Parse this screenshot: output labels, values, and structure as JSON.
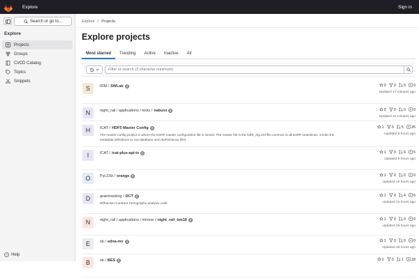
{
  "topbar": {
    "app_name": "Explore",
    "sign_in": "Sign in"
  },
  "sidebar": {
    "search_label": "Search or go to...",
    "title": "Explore",
    "items": [
      {
        "label": "Projects",
        "icon": "project-icon",
        "active": true
      },
      {
        "label": "Groups",
        "icon": "group-icon",
        "active": false
      },
      {
        "label": "CI/CD Catalog",
        "icon": "catalog-icon",
        "active": false
      },
      {
        "label": "Topics",
        "icon": "label-icon",
        "active": false
      },
      {
        "label": "Snippets",
        "icon": "snippet-icon",
        "active": false
      }
    ],
    "help": "Help"
  },
  "breadcrumb": {
    "root": "Explore",
    "sep": "/",
    "current": "Projects"
  },
  "page_title": "Explore projects",
  "tabs": [
    {
      "label": "Most starred",
      "active": true
    },
    {
      "label": "Trending",
      "active": false
    },
    {
      "label": "Active",
      "active": false
    },
    {
      "label": "Inactive",
      "active": false
    },
    {
      "label": "All",
      "active": false
    }
  ],
  "filter": {
    "placeholder": "Filter or search (3 character minimum)"
  },
  "projects": [
    {
      "letter": "S",
      "avatar_color": "#f5e9d4",
      "namespace": "IDM / ",
      "name": "SWLab",
      "desc": "",
      "stars": "0",
      "forks": "0",
      "mrs": "0",
      "issues": "0",
      "updated": "Updated 17 minutes ago"
    },
    {
      "letter": "N",
      "avatar_color": "#e7e5f5",
      "namespace": "night_rail / applications / tools / ",
      "name": "nabuxx",
      "desc": "",
      "stars": "0",
      "forks": "0",
      "mrs": "0",
      "issues": "0",
      "updated": "Updated 22 minutes ago"
    },
    {
      "letter": "H",
      "avatar_color": "#e7e5f5",
      "namespace": "ICAT / ",
      "name": "HDF5 Master Config",
      "desc": "The master-config project is where the ESRF master configuration file is stored. The master file is the hdf5_cfg.xml file common to all ESRF beamlines. It links the metadata definitions to icat database and HDF5/Nexus files.",
      "stars": "1",
      "forks": "5",
      "mrs": "5",
      "issues": "26",
      "updated": "Updated 8 hours ago"
    },
    {
      "letter": "I",
      "avatar_color": "#e7e5f5",
      "namespace": "ICAT / ",
      "name": "icat-plus-api-ts",
      "desc": "",
      "stars": "1",
      "forks": "0",
      "mrs": "0",
      "issues": "5",
      "updated": "Updated 8 hours ago"
    },
    {
      "letter": "O",
      "avatar_color": "#e1ecf5",
      "namespace": "PyLOSt / ",
      "name": "orange",
      "desc": "",
      "stars": "1",
      "forks": "0",
      "mrs": "0",
      "issues": "0",
      "updated": "Updated 10 hours ago"
    },
    {
      "letter": "D",
      "avatar_color": "#e7e5f5",
      "namespace": "graintracking / ",
      "name": "DCT",
      "desc": "Diffraction Contrast Tomography analysis code",
      "stars": "1",
      "forks": "0",
      "mrs": "4",
      "issues": "6",
      "updated": "Updated 13 hours ago"
    },
    {
      "letter": "N",
      "avatar_color": "#fbe5e1",
      "namespace": "night_rail / applications / mirone / ",
      "name": "night_rail_bm18",
      "desc": "",
      "stars": "1",
      "forks": "0",
      "mrs": "0",
      "issues": "0",
      "updated": "Updated 18 hours ago"
    },
    {
      "letter": "E",
      "avatar_color": "#ececef",
      "namespace": "sb / ",
      "name": "edna-mx",
      "desc": "",
      "stars": "1",
      "forks": "0",
      "mrs": "0",
      "issues": "0",
      "updated": "Updated 18 hours ago"
    },
    {
      "letter": "B",
      "avatar_color": "#fbe5e1",
      "namespace": "sb / ",
      "name": "BES",
      "desc": "",
      "stars": "1",
      "forks": "0",
      "mrs": "1",
      "issues": "18",
      "updated": ""
    }
  ]
}
